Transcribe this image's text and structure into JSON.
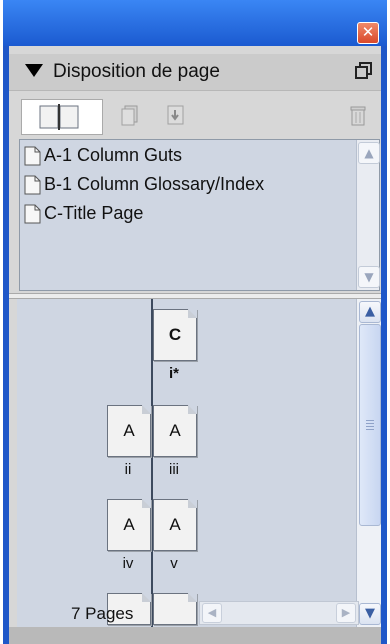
{
  "panel": {
    "title": "Disposition de page",
    "close_glyph": "✕"
  },
  "masters": [
    {
      "label": "A-1 Column Guts"
    },
    {
      "label": "B-1 Column Glossary/Index"
    },
    {
      "label": "C-Title Page"
    }
  ],
  "pages": {
    "spread1": {
      "right_letter": "C",
      "label": "i*"
    },
    "spread2": {
      "left_letter": "A",
      "right_letter": "A",
      "left_label": "ii",
      "right_label": "iii"
    },
    "spread3": {
      "left_letter": "A",
      "right_letter": "A",
      "left_label": "iv",
      "right_label": "v"
    }
  },
  "status": {
    "page_count": "7 Pages"
  },
  "icons": {
    "collapse": "triangle-down-icon",
    "menu": "panel-menu-icon",
    "new_page": "new-page-icon",
    "load_master": "load-master-icon",
    "delete": "trash-icon"
  }
}
